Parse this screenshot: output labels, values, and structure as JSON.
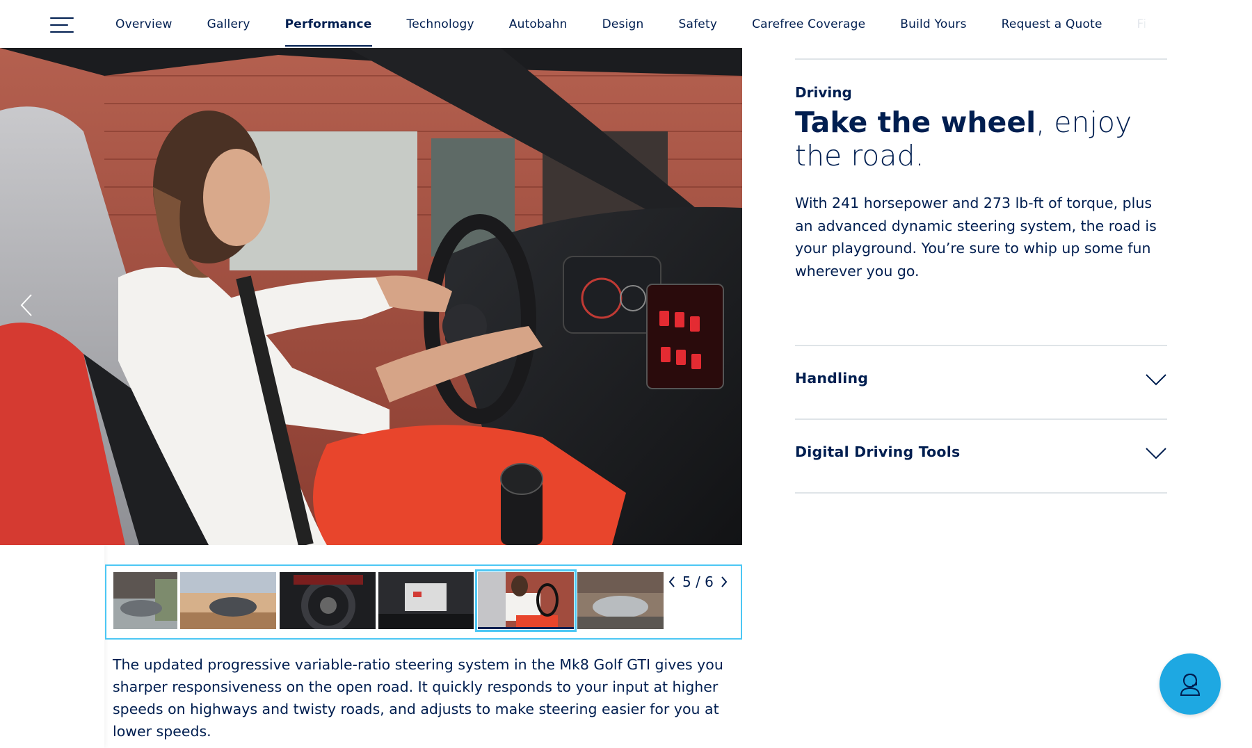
{
  "nav": {
    "menu_icon": "hamburger-menu-icon",
    "items": [
      {
        "label": "Overview"
      },
      {
        "label": "Gallery"
      },
      {
        "label": "Performance",
        "active": true
      },
      {
        "label": "Technology"
      },
      {
        "label": "Autobahn"
      },
      {
        "label": "Design"
      },
      {
        "label": "Safety"
      },
      {
        "label": "Carefree Coverage"
      },
      {
        "label": "Build Yours"
      },
      {
        "label": "Request a Quote"
      },
      {
        "label": "Fi"
      }
    ]
  },
  "gallery": {
    "counter": "5 / 6",
    "current": 5,
    "total": 6,
    "thumbnails": [
      "exterior-street",
      "exterior-desert",
      "steering-wheel",
      "infotainment",
      "driver-interior",
      "front-exterior"
    ]
  },
  "caption": "The updated progressive variable-ratio steering system in the Mk8 Golf GTI gives you sharper responsiveness on the open road. It quickly responds to your input at higher speeds on highways and twisty roads, and adjusts to make steering easier for you at lower speeds.",
  "content": {
    "eyebrow": "Driving",
    "headline_bold": "Take the wheel",
    "headline_rest": ", enjoy the road.",
    "body": "With 241 horsepower and 273 lb-ft of torque, plus an advanced dynamic steering system, the road is your playground. You’re sure to whip up some fun wherever you go."
  },
  "accordions": [
    {
      "label": "Handling",
      "icon": "chevron-down-icon"
    },
    {
      "label": "Digital Driving Tools",
      "icon": "chevron-down-icon"
    }
  ],
  "colors": {
    "brand_navy": "#001e50",
    "accent_blue": "#4cc7f4",
    "fab_blue": "#1ea8e2",
    "divider": "#dfe4e8"
  },
  "fab": {
    "icon": "chat-agent-icon"
  }
}
